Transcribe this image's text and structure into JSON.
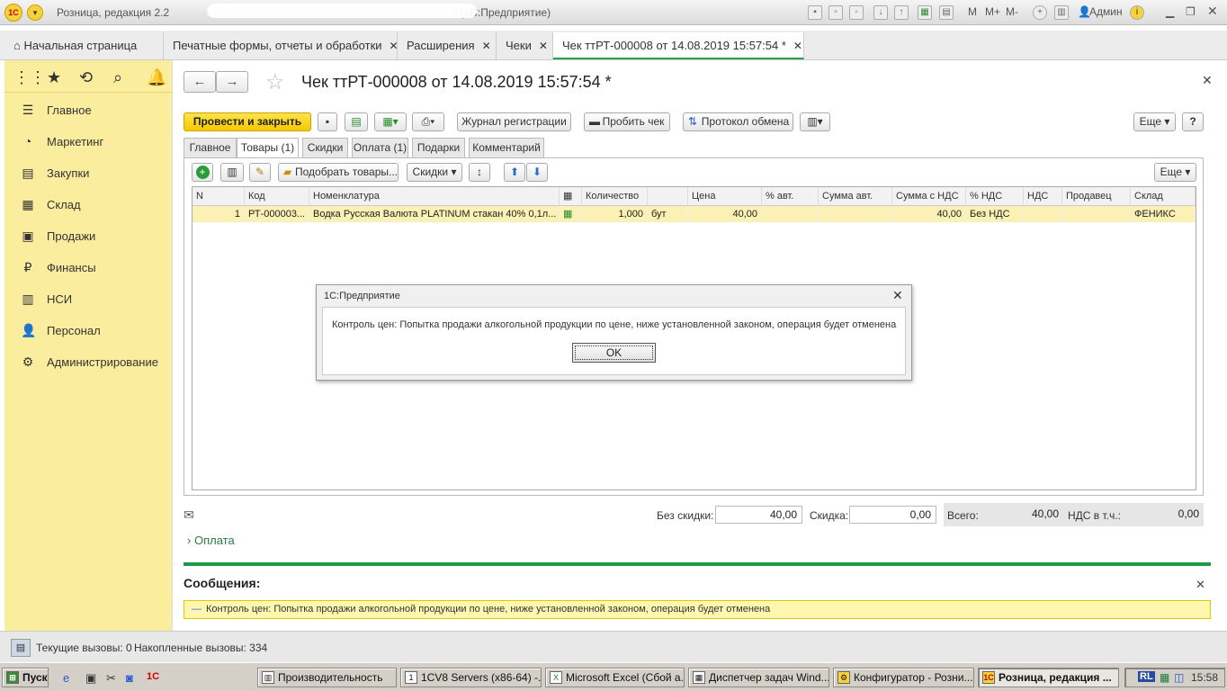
{
  "window": {
    "title_prefix": "Розница, редакция 2.2",
    "title_suffix": "/ (1С:Предприятие)",
    "user": "Админ",
    "zoom_buttons": [
      "M",
      "M+",
      "M-"
    ]
  },
  "tabs": [
    {
      "label": "Начальная страница"
    },
    {
      "label": "Печатные формы, отчеты и обработки"
    },
    {
      "label": "Расширения"
    },
    {
      "label": "Чеки"
    },
    {
      "label": "Чек ттРТ-000008 от 14.08.2019 15:57:54 *"
    }
  ],
  "sidebar": {
    "items": [
      {
        "label": "Главное",
        "icon": "menu-icon"
      },
      {
        "label": "Маркетинг",
        "icon": "chart-icon"
      },
      {
        "label": "Закупки",
        "icon": "cart-icon"
      },
      {
        "label": "Склад",
        "icon": "warehouse-icon"
      },
      {
        "label": "Продажи",
        "icon": "shop-icon"
      },
      {
        "label": "Финансы",
        "icon": "ruble-icon"
      },
      {
        "label": "НСИ",
        "icon": "reference-icon"
      },
      {
        "label": "Персонал",
        "icon": "person-icon"
      },
      {
        "label": "Администрирование",
        "icon": "gear-icon"
      }
    ]
  },
  "document": {
    "title": "Чек ттРТ-000008 от 14.08.2019 15:57:54 *",
    "toolbar": {
      "post_close": "Провести и закрыть",
      "journal": "Журнал регистрации",
      "punch": "Пробить чек",
      "protocol": "Протокол обмена",
      "more": "Еще",
      "help": "?"
    },
    "form_tabs": [
      "Главное",
      "Товары (1)",
      "Скидки",
      "Оплата (1)",
      "Подарки",
      "Комментарий"
    ],
    "table_toolbar": {
      "pick": "Подобрать товары...",
      "discounts": "Скидки",
      "more": "Еще"
    },
    "columns": [
      "N",
      "Код",
      "Номенклатура",
      "",
      "Количество",
      "",
      "Цена",
      "% авт.",
      "Сумма авт.",
      "Сумма с НДС",
      "% НДС",
      "НДС",
      "Продавец",
      "Склад"
    ],
    "rows": [
      {
        "n": "1",
        "code": "РТ-000003...",
        "name": "Водка Русская Валюта PLATINUM стакан 40% 0,1л...",
        "qty": "1,000",
        "unit": "бут",
        "price": "40,00",
        "auto_pct": "",
        "auto_sum": "",
        "sum_vat": "40,00",
        "vat_pct": "Без НДС",
        "vat": "",
        "seller": "",
        "warehouse": "ФЕНИКС"
      }
    ],
    "footer": {
      "no_discount_label": "Без скидки:",
      "no_discount_value": "40,00",
      "discount_label": "Скидка:",
      "discount_value": "0,00",
      "total_label": "Всего:",
      "total_value": "40,00",
      "vat_label": "НДС в т.ч.:",
      "vat_value": "0,00",
      "payment_link": "Оплата"
    }
  },
  "dialog": {
    "title": "1С:Предприятие",
    "message": "Контроль цен: Попытка продажи алкогольной продукции по цене, ниже установленной законом, операция будет отменена",
    "ok": "OK"
  },
  "messages": {
    "header": "Сообщения:",
    "items": [
      "Контроль цен: Попытка продажи алкогольной продукции по цене, ниже установленной законом, операция будет отменена"
    ]
  },
  "status": {
    "current_calls": "Текущие вызовы: 0",
    "accumulated_calls": "Накопленные вызовы: 334"
  },
  "taskbar": {
    "start": "Пуск",
    "items": [
      "Производительность",
      "1CV8 Servers (x86-64) -...",
      "Microsoft Excel (Сбой а...",
      "Диспетчер задач Wind...",
      "Конфигуратор - Розни...",
      "Розница, редакция ..."
    ],
    "lang": "RL",
    "clock": "15:58"
  }
}
